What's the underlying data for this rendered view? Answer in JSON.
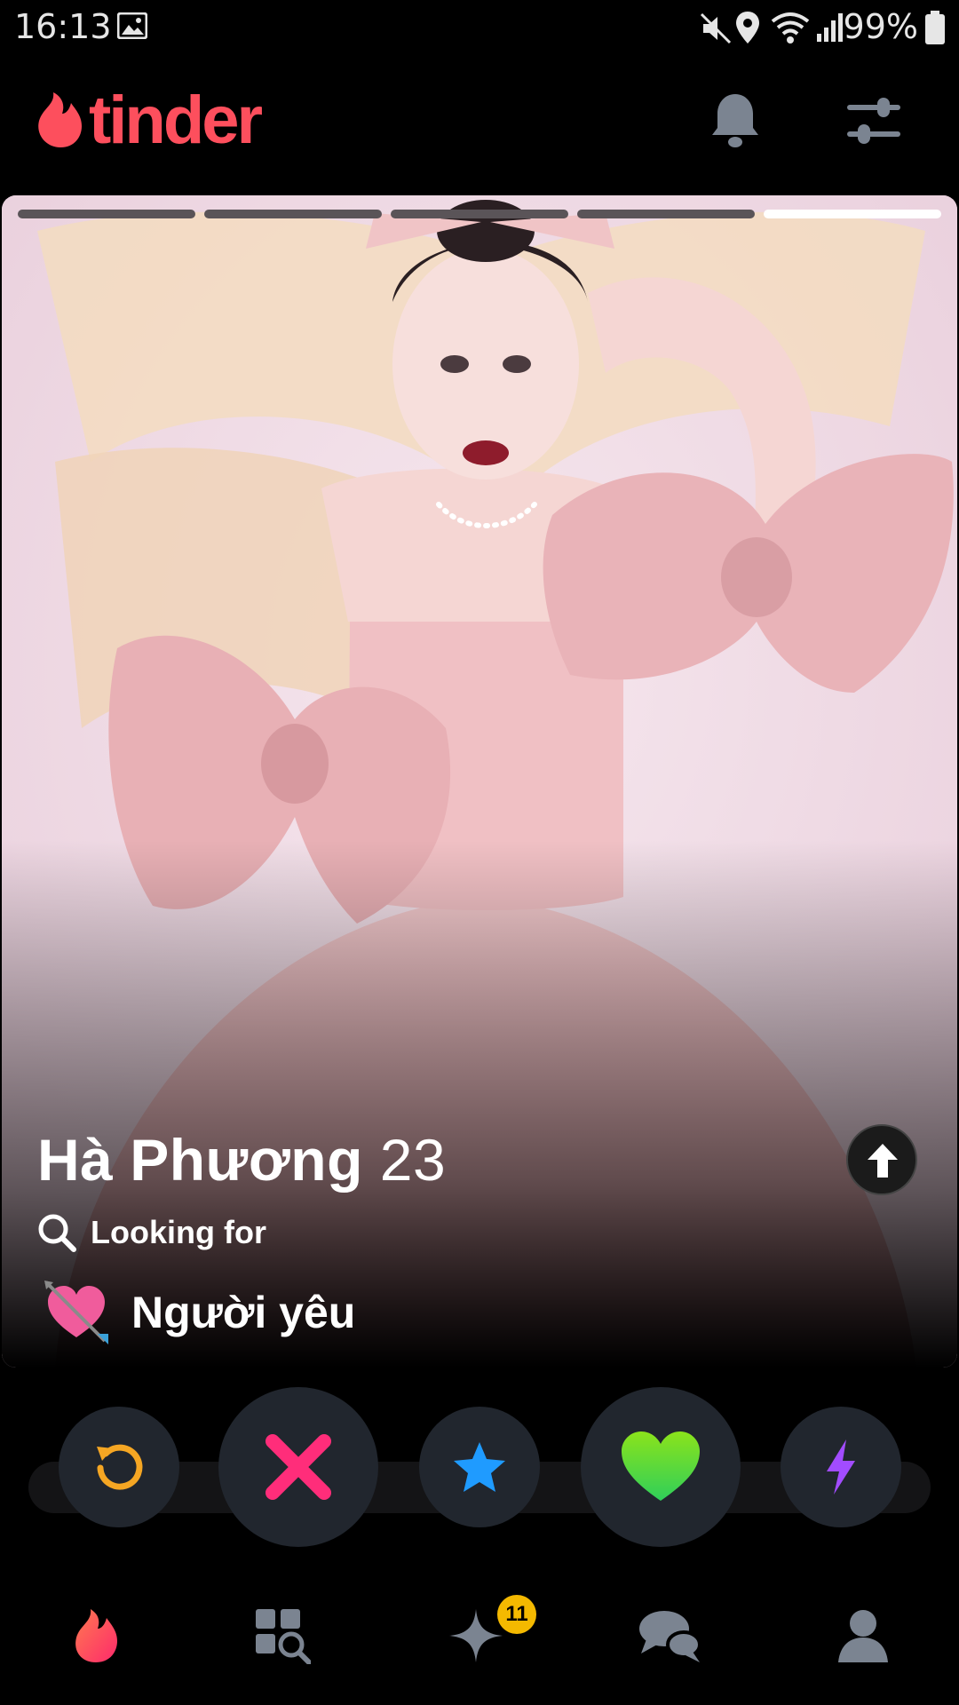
{
  "status_bar": {
    "time": "16:13",
    "battery": "99%"
  },
  "header": {
    "logo_text": "tinder"
  },
  "card": {
    "photo_count": 5,
    "active_photo_index": 5,
    "name": "Hà Phương",
    "age": "23",
    "looking_for_label": "Looking for",
    "relationship_goal": "Người yêu"
  },
  "actions": {
    "rewind": "rewind-icon",
    "nope": "close-icon",
    "super_like": "star-icon",
    "like": "heart-icon",
    "boost": "lightning-icon"
  },
  "bottom_nav": {
    "items": [
      "home-flame-icon",
      "explore-icon",
      "gold-spark-icon",
      "messages-icon",
      "profile-icon"
    ],
    "gold_badge_count": "11"
  },
  "colors": {
    "brand": "#fd4f5d",
    "rewind": "#f5a623",
    "nope": "#ff2d7a",
    "super_like": "#1f9bff",
    "like": "#5bdc1e",
    "boost": "#a24cff",
    "badge": "#f4b900"
  }
}
